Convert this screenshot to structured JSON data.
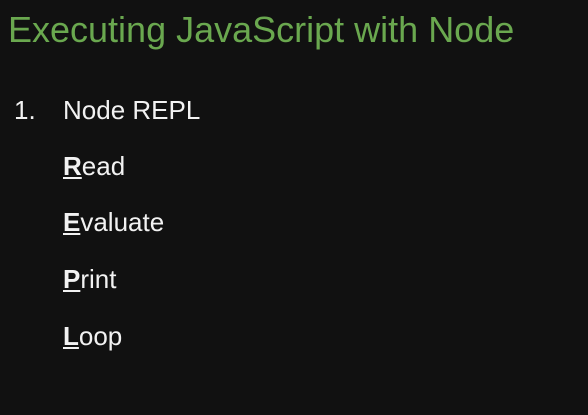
{
  "slide": {
    "title": "Executing JavaScript with Node",
    "list_item": {
      "number": "1.",
      "label": "Node REPL"
    },
    "acronym": [
      {
        "initial": "R",
        "rest": "ead"
      },
      {
        "initial": "E",
        "rest": "valuate"
      },
      {
        "initial": "P",
        "rest": "rint"
      },
      {
        "initial": "L",
        "rest": "oop"
      }
    ]
  },
  "colors": {
    "background": "#111111",
    "title": "#6aa84f",
    "text": "#f2f2f2"
  }
}
